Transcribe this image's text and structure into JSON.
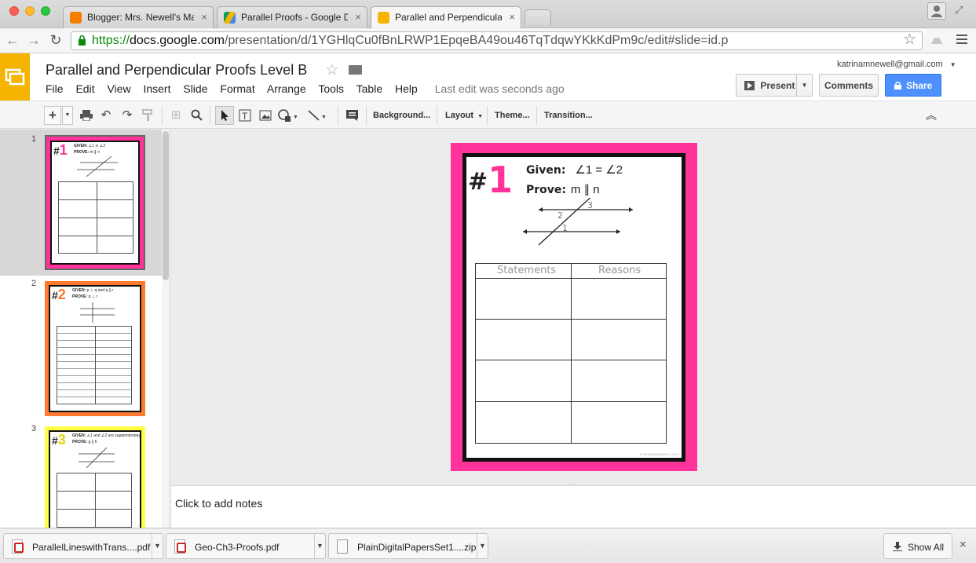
{
  "browser": {
    "tabs": [
      {
        "label": "Blogger: Mrs. Newell's Math",
        "favicon_color": "#f57d00"
      },
      {
        "label": "Parallel Proofs - Google Dr",
        "favicon_color": "#4285f4"
      },
      {
        "label": "Parallel and Perpendicular",
        "favicon_color": "#f4b400"
      }
    ],
    "url_scheme": "https://",
    "url_domain": "docs.google.com",
    "url_path": "/presentation/d/1YGHlqCu0fBnLRWP1EpqeBA49ou46TqTdqwYKkKdPm9c/edit#slide=id.p"
  },
  "doc": {
    "title": "Parallel and Perpendicular Proofs Level B",
    "account": "katrinamnewell@gmail.com",
    "menu": [
      "File",
      "Edit",
      "View",
      "Insert",
      "Slide",
      "Format",
      "Arrange",
      "Tools",
      "Table",
      "Help"
    ],
    "last_edit": "Last edit was seconds ago",
    "present_label": "Present",
    "comments_label": "Comments",
    "share_label": "Share",
    "accent_color": "#f4b400",
    "share_color": "#4d90fe"
  },
  "toolbar": {
    "background": "Background...",
    "layout": "Layout",
    "theme": "Theme...",
    "transition": "Transition..."
  },
  "slides": [
    {
      "number": "1",
      "title_num": "1",
      "given": "∠1 ≅ ∠2",
      "prove": "m ∥ n",
      "border_color": "#ff3399"
    },
    {
      "number": "2",
      "title_num": "2",
      "given": "p ⊥ q and q ∥ r",
      "prove": "p ⊥ r",
      "border_color": "#ff7a30"
    },
    {
      "number": "3",
      "title_num": "3",
      "given": "∠1 and ∠2 are supplementary",
      "prove": "g ∥ h",
      "border_color": "#ffff44"
    }
  ],
  "main_slide": {
    "title_num": "1",
    "given_label": "Given:",
    "given_value": "∠1 = ∠2",
    "prove_label": "Prove:",
    "prove_value": "m ∥ n",
    "angle1": "1",
    "angle2": "2",
    "angle3": "3",
    "col1": "Statements",
    "col2": "Reasons",
    "footer": "©KATRINAMNEWELL 2014"
  },
  "notes_placeholder": "Click to add notes",
  "downloads": {
    "items": [
      "ParallelLineswithTrans....pdf",
      "Geo-Ch3-Proofs.pdf",
      "PlainDigitalPapersSet1....zip"
    ],
    "show_all": "Show All"
  }
}
